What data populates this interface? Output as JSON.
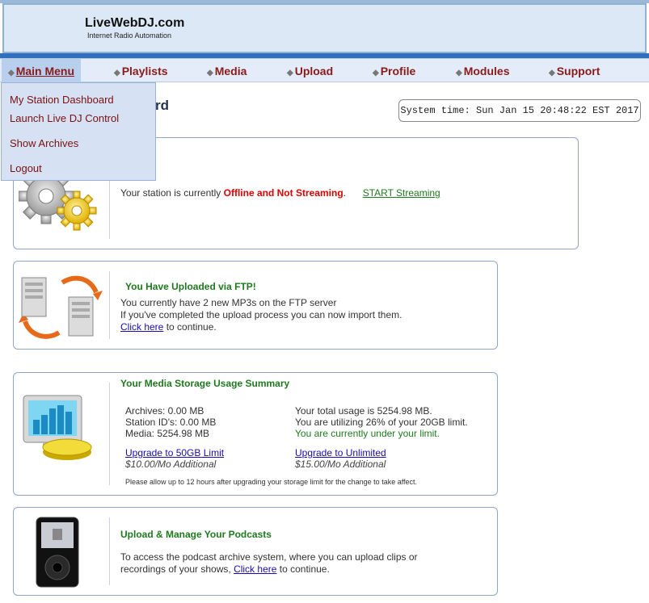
{
  "brand": {
    "title": "LiveWebDJ.com",
    "subtitle": "Internet Radio Automation"
  },
  "nav": [
    {
      "label": "Main Menu"
    },
    {
      "label": "Playlists"
    },
    {
      "label": "Media"
    },
    {
      "label": "Upload"
    },
    {
      "label": "Profile"
    },
    {
      "label": "Modules"
    },
    {
      "label": "Support"
    }
  ],
  "dropdown": [
    {
      "label": "My Station Dashboard"
    },
    {
      "label": "Launch Live DJ Control"
    },
    {
      "label": "Show Archives"
    },
    {
      "label": "Logout"
    }
  ],
  "page_title_visible": "rd",
  "system_time": "System time: Sun Jan 15 20:48:22 EST 2017",
  "status_card": {
    "text_prefix": "Your station is currently",
    "status": "Offline and Not Streaming",
    "text_suffix": ".",
    "action": "START Streaming"
  },
  "ftp_card": {
    "heading": "You Have Uploaded via FTP!",
    "line1": "You currently have 2 new MP3s on the FTP server",
    "line2": "If you've completed the upload process you can now import them.",
    "link": "Click here",
    "line3_suffix": " to continue."
  },
  "storage_card": {
    "heading": "Your Media Storage Usage Summary",
    "archives": "Archives: 0.00 MB",
    "station_ids": "Station ID's: 0.00 MB",
    "media": "Media: 5254.98 MB",
    "total": "Your total usage is 5254.98 MB.",
    "utilizing": "You are utilizing 26% of your 20GB limit.",
    "under_limit": "You are currently under your limit.",
    "upgrade1": "Upgrade to 50GB Limit",
    "price1": "$10.00/Mo Additional",
    "upgrade2": "Upgrade to Unlimited",
    "price2": "$15.00/Mo Additional",
    "note": "Please allow up to 12 hours after upgrading your storage limit for the change to take affect."
  },
  "podcast_card": {
    "heading": "Upload & Manage Your Podcasts",
    "line1": "To access the podcast archive system, where you can upload clips or",
    "line2_prefix": "recordings of your shows, ",
    "link": "Click here",
    "line2_suffix": " to continue."
  },
  "colors": {
    "accent_bar": "#2f6fbd",
    "nav_text": "#8b1a1a",
    "green": "#1f7a1f",
    "red": "#e00000"
  },
  "icons": [
    "gears-icon",
    "servers-sync-icon",
    "storage-chart-icon",
    "media-player-icon"
  ]
}
